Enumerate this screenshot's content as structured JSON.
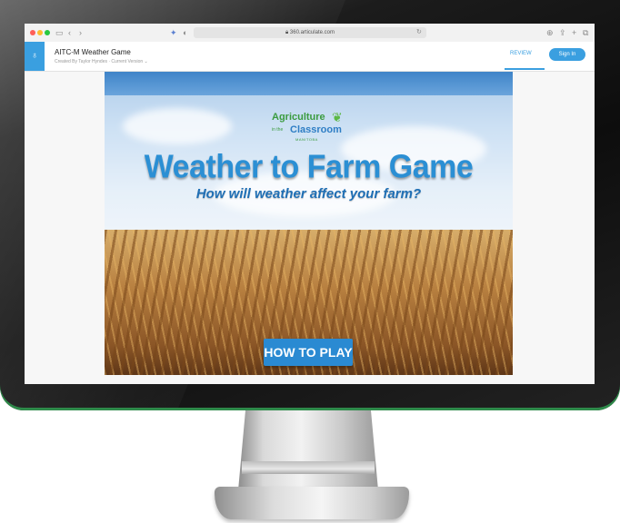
{
  "browser": {
    "url": "360.articulate.com"
  },
  "app": {
    "logo_glyph": "♁",
    "title": "AITC-M Weather Game",
    "subtitle": "Created By Taylor Hyndes  ·  Current Version ⌄",
    "review_label": "REVIEW",
    "signin_label": "Sign In"
  },
  "slide": {
    "logo_line1": "Agriculture",
    "logo_small": "in the",
    "logo_line2": "Classroom",
    "logo_tag": "MANITOBA",
    "title": "Weather to Farm Game",
    "subtitle_pre": "How will weather affect ",
    "subtitle_em": "your",
    "subtitle_post": " farm?",
    "button_label": "HOW TO PLAY"
  },
  "colors": {
    "accent": "#3a9fe0",
    "title_blue": "#2b8fd4",
    "logo_green": "#3b9b3f"
  }
}
